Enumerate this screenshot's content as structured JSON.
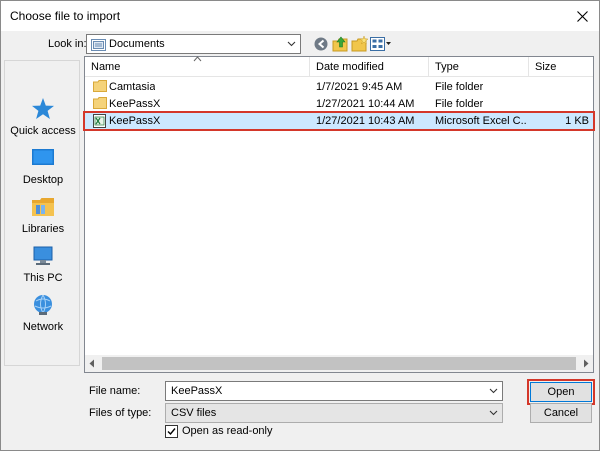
{
  "window": {
    "title": "Choose file to import"
  },
  "lookin": {
    "label": "Look in:",
    "value": "Documents"
  },
  "toolbar": {
    "icons": [
      "back-icon",
      "up-folder-icon",
      "new-folder-icon",
      "view-menu-icon"
    ]
  },
  "places": [
    {
      "id": "quick-access",
      "label": "Quick access",
      "icon": "star-icon"
    },
    {
      "id": "desktop",
      "label": "Desktop",
      "icon": "desktop-icon"
    },
    {
      "id": "libraries",
      "label": "Libraries",
      "icon": "libraries-icon"
    },
    {
      "id": "this-pc",
      "label": "This PC",
      "icon": "computer-icon"
    },
    {
      "id": "network",
      "label": "Network",
      "icon": "network-icon"
    }
  ],
  "columns": {
    "name": "Name",
    "date": "Date modified",
    "type": "Type",
    "size": "Size"
  },
  "files": [
    {
      "name": "Camtasia",
      "date": "1/7/2021 9:45 AM",
      "type": "File folder",
      "size": "",
      "icon": "folder-icon",
      "selected": false
    },
    {
      "name": "KeePassX",
      "date": "1/27/2021 10:44 AM",
      "type": "File folder",
      "size": "",
      "icon": "folder-icon",
      "selected": false
    },
    {
      "name": "KeePassX",
      "date": "1/27/2021 10:43 AM",
      "type": "Microsoft Excel C...",
      "size": "1 KB",
      "icon": "excel-csv-icon",
      "selected": true
    }
  ],
  "filename": {
    "label": "File name:",
    "value": "KeePassX"
  },
  "filetype": {
    "label": "Files of type:",
    "value": "CSV files"
  },
  "readonly": {
    "label": "Open as read-only",
    "checked": true
  },
  "buttons": {
    "open": "Open",
    "cancel": "Cancel"
  },
  "colors": {
    "selection": "#cce8ff",
    "highlight": "#d4372a",
    "accent": "#0078d7"
  }
}
